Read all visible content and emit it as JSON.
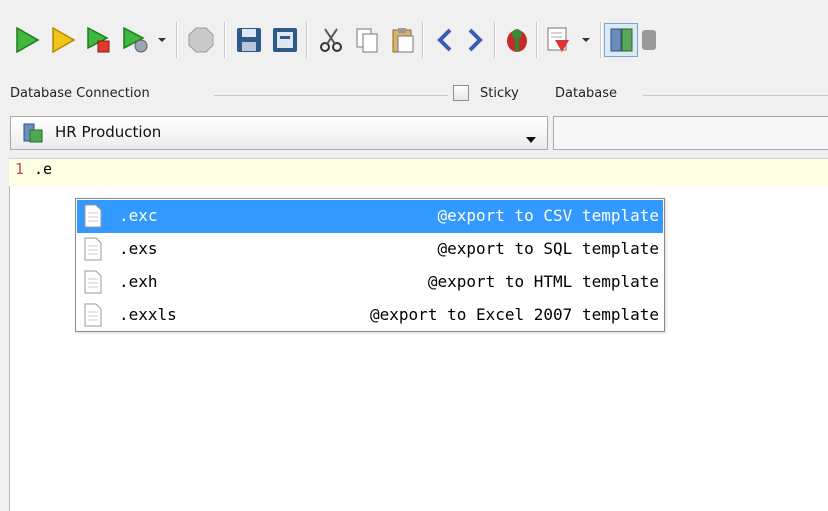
{
  "toolbar": {
    "icons": [
      "run-icon",
      "run-current-icon",
      "run-to-end-icon",
      "run-from-cursor-icon",
      "stop-icon",
      "save-icon",
      "save-as-icon",
      "cut-icon",
      "copy-icon",
      "paste-icon",
      "back-icon",
      "forward-icon",
      "bug-icon",
      "export-icon",
      "database-icon"
    ]
  },
  "connection": {
    "label": "Database Connection",
    "selected": "HR Production",
    "sticky_label": "Sticky",
    "database_label": "Database",
    "database_value": ""
  },
  "editor": {
    "line_number": "1",
    "line_text": ".e"
  },
  "autocomplete": {
    "items": [
      {
        "name": ".exc",
        "desc": "@export to CSV template",
        "selected": true
      },
      {
        "name": ".exs",
        "desc": "@export to SQL template",
        "selected": false
      },
      {
        "name": ".exh",
        "desc": "@export to HTML template",
        "selected": false
      },
      {
        "name": ".exxls",
        "desc": "@export to Excel 2007 template",
        "selected": false
      }
    ]
  },
  "colors": {
    "selection": "#3399ff",
    "current_line": "#ffffe3",
    "line_number": "#c0504d"
  }
}
